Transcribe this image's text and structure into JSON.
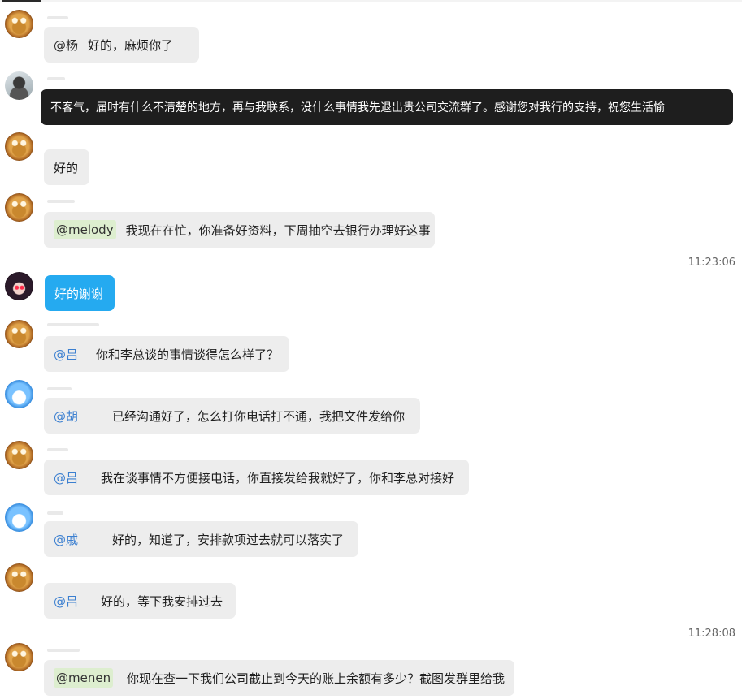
{
  "messages": [
    {
      "avatar": "owl-avatar",
      "mention": "@杨",
      "text": "好的，麻烦你了"
    },
    {
      "avatar": "photo-avatar",
      "mention": "",
      "text": "不客气，届时有什么不清楚的地方，再与我联系，没什么事情我先退出贵公司交流群了。感谢您对我行的支持，祝您生活愉"
    },
    {
      "avatar": "owl-avatar",
      "mention": "",
      "text": "好的"
    },
    {
      "avatar": "owl-avatar",
      "mention": "@melody",
      "text": "我现在在忙，你准备好资料，下周抽空去银行办理好这事"
    },
    {
      "avatar": "anime-avatar",
      "mention": "",
      "text": "好的谢谢"
    },
    {
      "avatar": "owl-avatar",
      "mention": "@吕",
      "text": "你和李总谈的事情谈得怎么样了？"
    },
    {
      "avatar": "blue-avatar",
      "mention": "@胡",
      "text": "已经沟通好了，怎么打你电话打不通，我把文件发给你"
    },
    {
      "avatar": "owl-avatar",
      "mention": "@吕",
      "text": "我在谈事情不方便接电话，你直接发给我就好了，你和李总对接好"
    },
    {
      "avatar": "blue-avatar",
      "mention": "@戚",
      "text": "好的，知道了，安排款项过去就可以落实了"
    },
    {
      "avatar": "owl-avatar",
      "mention": "@吕",
      "text": "好的，等下我安排过去"
    },
    {
      "avatar": "owl-avatar",
      "mention": "@menen",
      "text": "你现在查一下我们公司截止到今天的账上余额有多少？截图发群里给我"
    }
  ],
  "timestamps": [
    "11:23:06",
    "11:28:08"
  ]
}
